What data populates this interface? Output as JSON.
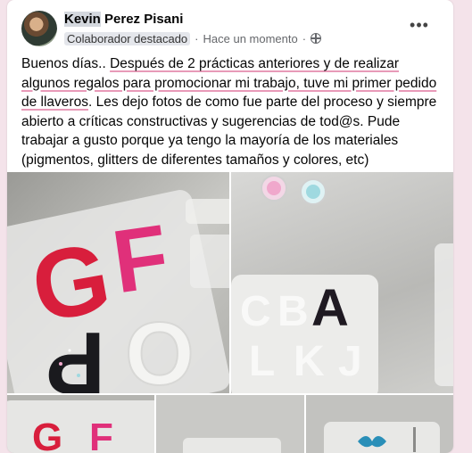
{
  "post": {
    "author_first": "Kevin",
    "author_rest": " Perez Pisani",
    "badge": "Colaborador destacado",
    "separator": "·",
    "time": "Hace un momento",
    "separator2": "·",
    "more": "•••",
    "text_part1": "Buenos días.. ",
    "text_part2": "Después de 2 prácticas anteriores y de realizar algunos regalos para promocionar mi trabajo, tuve mi primer pedido de llaveros",
    "text_part3": ". Les dejo fotos de como fue parte del proceso y siempre abierto a críticas constructivas y sugerencias de tod@s. Pude trabajar a gusto porque ya tengo la mayoría de los materiales (pigmentos, glitters de diferentes tamaños y colores, etc)"
  },
  "photos": {
    "p1_letters": [
      "G",
      "F",
      "O",
      "P"
    ],
    "p2_letters": [
      "A",
      "B",
      "C",
      "J",
      "K",
      "L"
    ],
    "p3_letters": [
      "G",
      "F"
    ]
  },
  "colors": {
    "resin_red": "#d81e3c",
    "resin_pink": "#e0307a",
    "resin_black": "#1a1a1e",
    "glitter_pink": "#f0a8cc",
    "glitter_blue": "#9fd9e0"
  }
}
